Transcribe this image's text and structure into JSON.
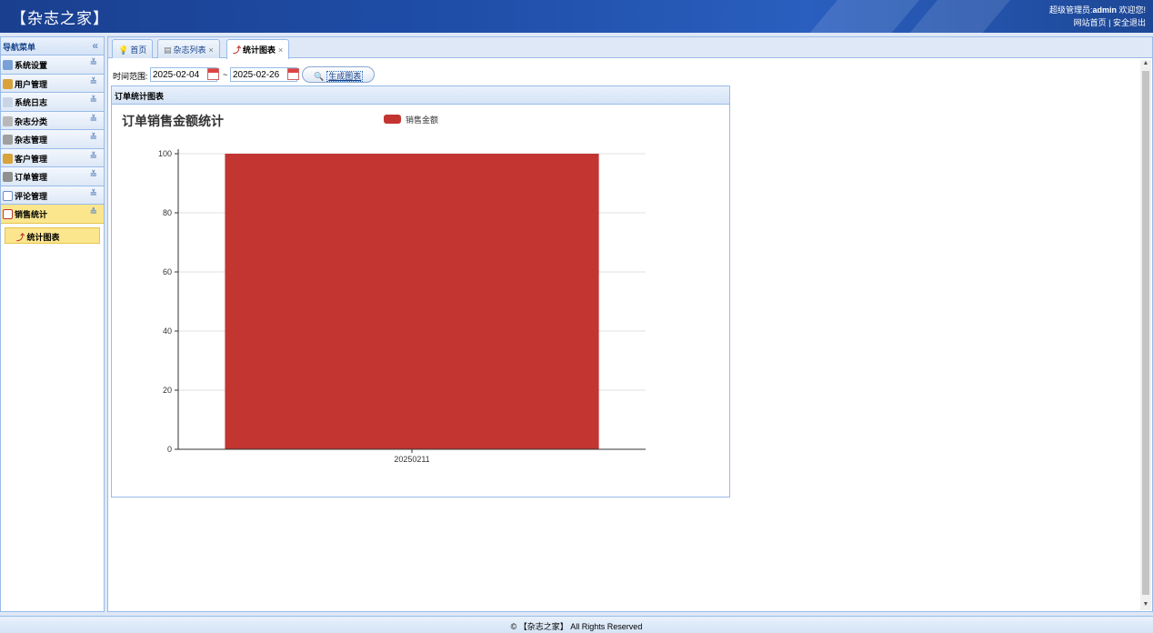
{
  "header": {
    "logo": "【杂志之家】",
    "user_label": "超级管理员:",
    "user_name": "admin",
    "welcome": "欢迎您!",
    "home_link": "网站首页",
    "separator": "|",
    "logout_link": "安全退出"
  },
  "sidebar": {
    "title": "导航菜单",
    "collapse_icon": "«",
    "groups": [
      {
        "label": "系统设置",
        "icon": "tools-icon"
      },
      {
        "label": "用户管理",
        "icon": "users-icon"
      },
      {
        "label": "系统日志",
        "icon": "log-icon"
      },
      {
        "label": "杂志分类",
        "icon": "category-icon"
      },
      {
        "label": "杂志管理",
        "icon": "magazine-icon"
      },
      {
        "label": "客户管理",
        "icon": "customers-icon"
      },
      {
        "label": "订单管理",
        "icon": "orders-icon"
      },
      {
        "label": "评论管理",
        "icon": "comment-icon"
      },
      {
        "label": "销售统计",
        "icon": "chart-icon",
        "active": true
      }
    ],
    "submenu": [
      {
        "label": "统计图表",
        "icon": "line-chart-icon"
      }
    ]
  },
  "tabs": [
    {
      "label": "首页",
      "icon": "bulb-icon",
      "closable": false
    },
    {
      "label": "杂志列表",
      "icon": "cart-icon",
      "closable": true
    },
    {
      "label": "统计图表",
      "icon": "line-chart-icon",
      "closable": true,
      "active": true
    }
  ],
  "tab_close": "×",
  "filter": {
    "label": "时间范围:",
    "start_date": "2025-02-04",
    "separator": "~",
    "end_date": "2025-02-26",
    "button_label": "生成图表"
  },
  "panel": {
    "title": "订单统计图表"
  },
  "chart_data": {
    "type": "bar",
    "title": "订单销售金额统计",
    "categories": [
      "20250211"
    ],
    "series": [
      {
        "name": "销售金额",
        "values": [
          100
        ],
        "color": "#c23531"
      }
    ],
    "xlabel": "",
    "ylabel": "",
    "ylim": [
      0,
      100
    ],
    "yticks": [
      0,
      20,
      40,
      60,
      80,
      100
    ],
    "grid": true,
    "legend": "top-center"
  },
  "footer": {
    "text": "© 【杂志之家】 All Rights Reserved"
  },
  "colors": {
    "header": "#1f4ea8",
    "border": "#99bbe8",
    "active": "#fbe68e",
    "bar": "#c23531"
  }
}
